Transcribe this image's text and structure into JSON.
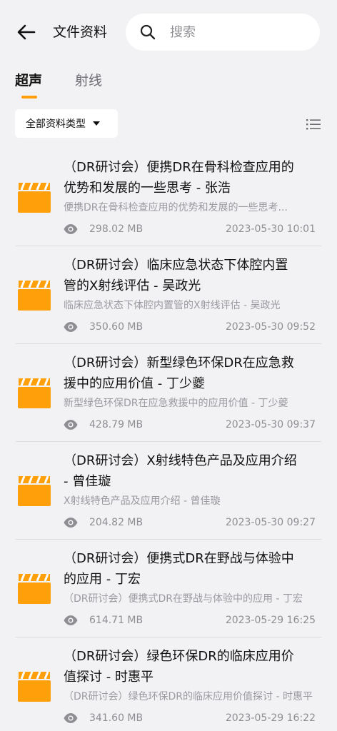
{
  "header": {
    "title": "文件资料",
    "search_placeholder": "搜索"
  },
  "tabs": [
    {
      "label": "超声",
      "active": true
    },
    {
      "label": "射线",
      "active": false
    }
  ],
  "filter": {
    "label": "全部资料类型"
  },
  "accent_color": "#ff9f0a",
  "files": [
    {
      "title": "（DR研讨会）便携DR在骨科检查应用的\n优势和发展的一些思考 - 张浩",
      "desc": "便携DR在骨科检查应用的优势和发展的一些思考...",
      "size": "298.02 MB",
      "date": "2023-05-30 10:01"
    },
    {
      "title": "（DR研讨会）临床应急状态下体腔内置\n管的X射线评估 - 吴政光",
      "desc": "临床应急状态下体腔内置管的X射线评估 - 吴政光",
      "size": "350.60 MB",
      "date": "2023-05-30 09:52"
    },
    {
      "title": "（DR研讨会）新型绿色环保DR在应急救\n援中的应用价值 - 丁少夔",
      "desc": "新型绿色环保DR在应急救援中的应用价值 - 丁少夔",
      "size": "428.79 MB",
      "date": "2023-05-30 09:37"
    },
    {
      "title": "（DR研讨会）X射线特色产品及应用介绍\n- 曾佳璇",
      "desc": "X射线特色产品及应用介绍 - 曾佳璇",
      "size": "204.82 MB",
      "date": "2023-05-30 09:27"
    },
    {
      "title": "（DR研讨会）便携式DR在野战与体验中\n的应用 - 丁宏",
      "desc": "（DR研讨会）便携式DR在野战与体验中的应用 - 丁宏",
      "size": "614.71 MB",
      "date": "2023-05-29 16:25"
    },
    {
      "title": "（DR研讨会）绿色环保DR的临床应用价\n值探讨 - 时惠平",
      "desc": "（DR研讨会）绿色环保DR的临床应用价值探讨 - 时惠平",
      "size": "341.60 MB",
      "date": "2023-05-29 16:22"
    }
  ]
}
